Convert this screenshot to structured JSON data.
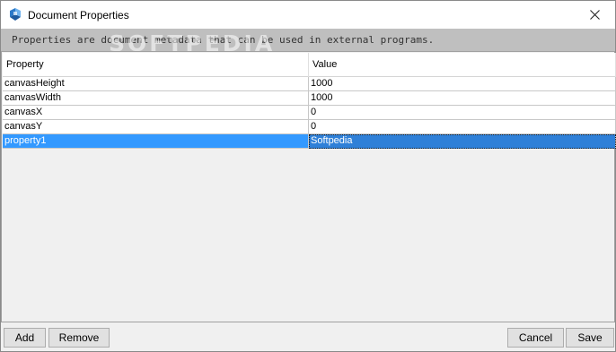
{
  "window": {
    "title": "Document Properties",
    "app_icon": "document-properties-app-icon",
    "close_icon": "close-icon"
  },
  "info_bar": {
    "text": "Properties are document metadata that can be used in external programs.",
    "watermark": "SOFTPEDIA"
  },
  "table": {
    "headers": [
      "Property",
      "Value"
    ],
    "rows": [
      {
        "property": "canvasHeight",
        "value": "1000",
        "selected": false
      },
      {
        "property": "canvasWidth",
        "value": "1000",
        "selected": false
      },
      {
        "property": "canvasX",
        "value": "0",
        "selected": false
      },
      {
        "property": "canvasY",
        "value": "0",
        "selected": false
      },
      {
        "property": "property1",
        "value": "Softpedia",
        "selected": true
      }
    ]
  },
  "buttons": {
    "add": "Add",
    "remove": "Remove",
    "cancel": "Cancel",
    "save": "Save"
  },
  "colors": {
    "selection": "#3399ff",
    "info_bar_bg": "#bfbfbf",
    "dialog_bg": "#f0f0f0"
  }
}
